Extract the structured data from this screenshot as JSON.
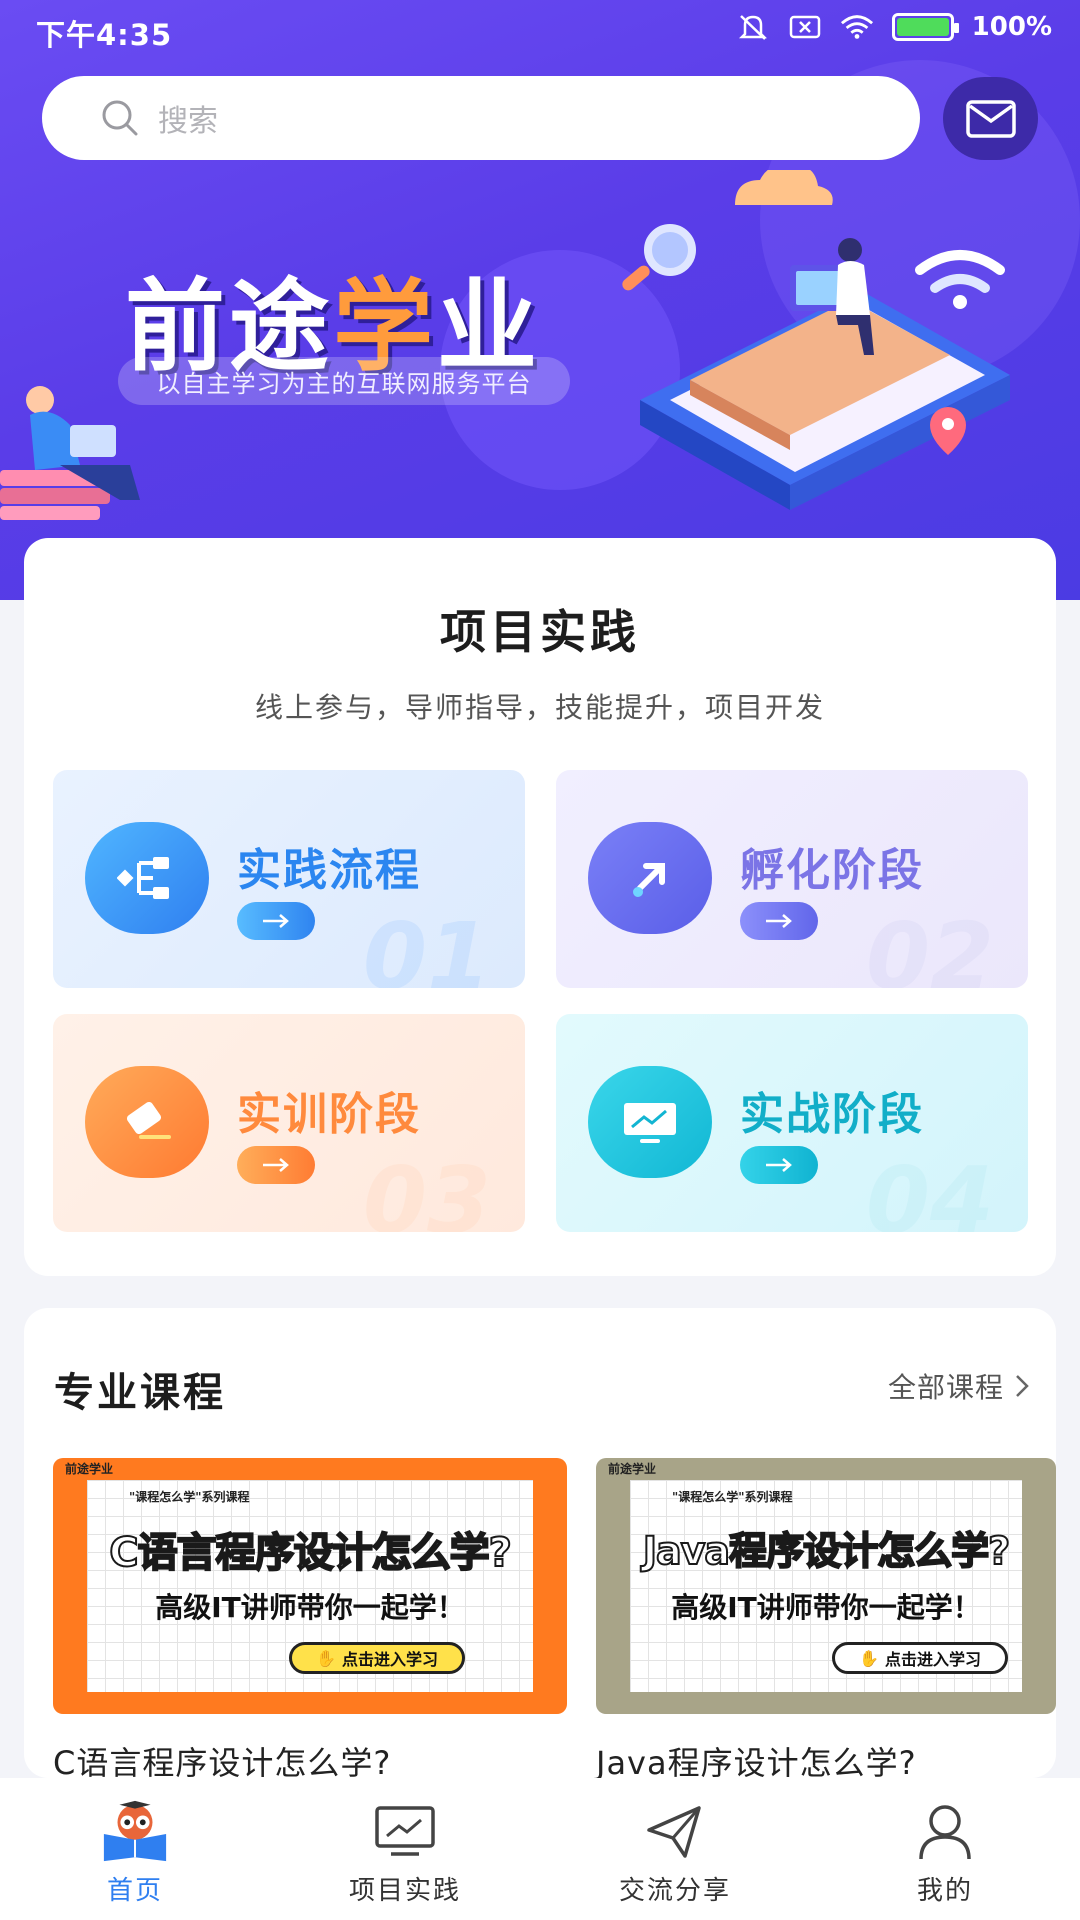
{
  "status_bar": {
    "time": "下午4:35",
    "battery": "100%"
  },
  "search": {
    "placeholder": "搜索"
  },
  "banner": {
    "brand_part1": "前途",
    "brand_part2": "学",
    "brand_part3": "业",
    "slogan": "以自主学习为主的互联网服务平台"
  },
  "practice": {
    "title": "项目实践",
    "subtitle": "线上参与，导师指导，技能提升，项目开发",
    "tiles": [
      {
        "label": "实践流程",
        "number": "01",
        "icon": "flow-icon"
      },
      {
        "label": "孵化阶段",
        "number": "02",
        "icon": "rocket-arrow-icon"
      },
      {
        "label": "实训阶段",
        "number": "03",
        "icon": "eraser-icon"
      },
      {
        "label": "实战阶段",
        "number": "04",
        "icon": "monitor-chart-icon"
      }
    ]
  },
  "courses": {
    "title": "专业课程",
    "all_label": "全部课程",
    "items": [
      {
        "name": "C语言程序设计怎么学?",
        "thumb_series": "\"课程怎么学\"系列课程",
        "thumb_title": "C语言程序设计怎么学?",
        "thumb_sub": "高级IT讲师带你一起学！",
        "thumb_cta": "点击进入学习",
        "thumb_brand": "前途学业",
        "accent": "#ff7a1f"
      },
      {
        "name": "Java程序设计怎么学?",
        "thumb_series": "\"课程怎么学\"系列课程",
        "thumb_title": "Java程序设计怎么学?",
        "thumb_sub": "高级IT讲师带你一起学！",
        "thumb_cta": "点击进入学习",
        "thumb_brand": "前途学业",
        "accent": "#a8a488"
      }
    ]
  },
  "nav": {
    "items": [
      {
        "label": "首页",
        "icon": "owl-book-icon",
        "active": true
      },
      {
        "label": "项目实践",
        "icon": "monitor-icon",
        "active": false
      },
      {
        "label": "交流分享",
        "icon": "paper-plane-icon",
        "active": false
      },
      {
        "label": "我的",
        "icon": "user-icon",
        "active": false
      }
    ]
  }
}
